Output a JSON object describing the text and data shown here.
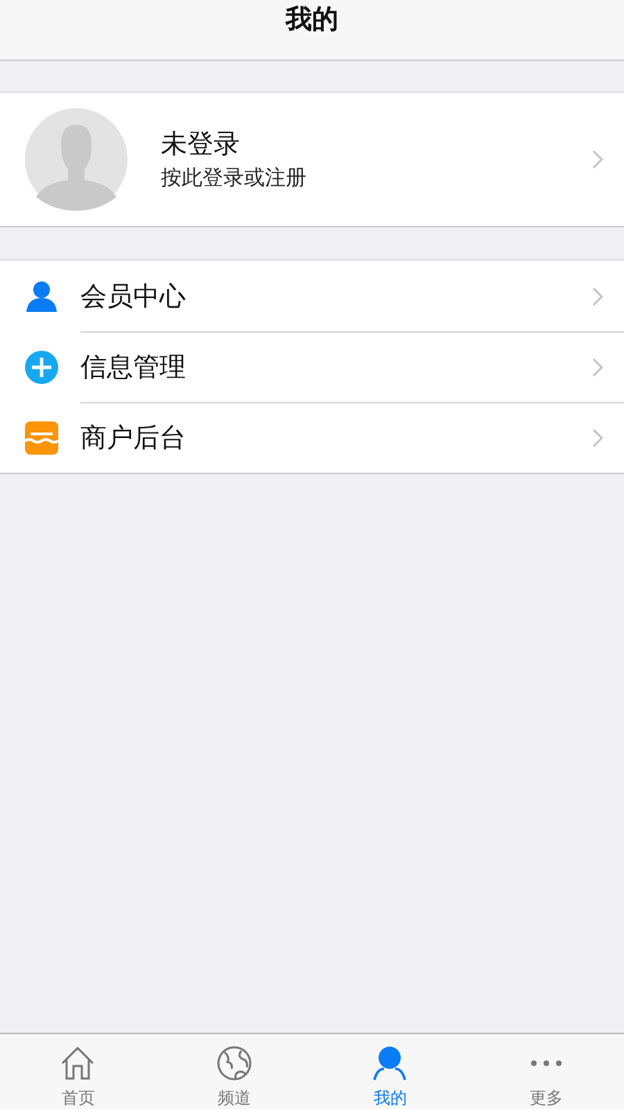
{
  "header": {
    "title": "我的"
  },
  "profile": {
    "name": "未登录",
    "hint": "按此登录或注册"
  },
  "menu": [
    {
      "kind": "member",
      "label": "会员中心"
    },
    {
      "kind": "info",
      "label": "信息管理"
    },
    {
      "kind": "shop",
      "label": "商户后台"
    }
  ],
  "tabs": [
    {
      "kind": "home",
      "label": "首页",
      "selected": false
    },
    {
      "kind": "globe",
      "label": "频道",
      "selected": false
    },
    {
      "kind": "person",
      "label": "我的",
      "selected": true
    },
    {
      "kind": "more",
      "label": "更多",
      "selected": false
    }
  ]
}
